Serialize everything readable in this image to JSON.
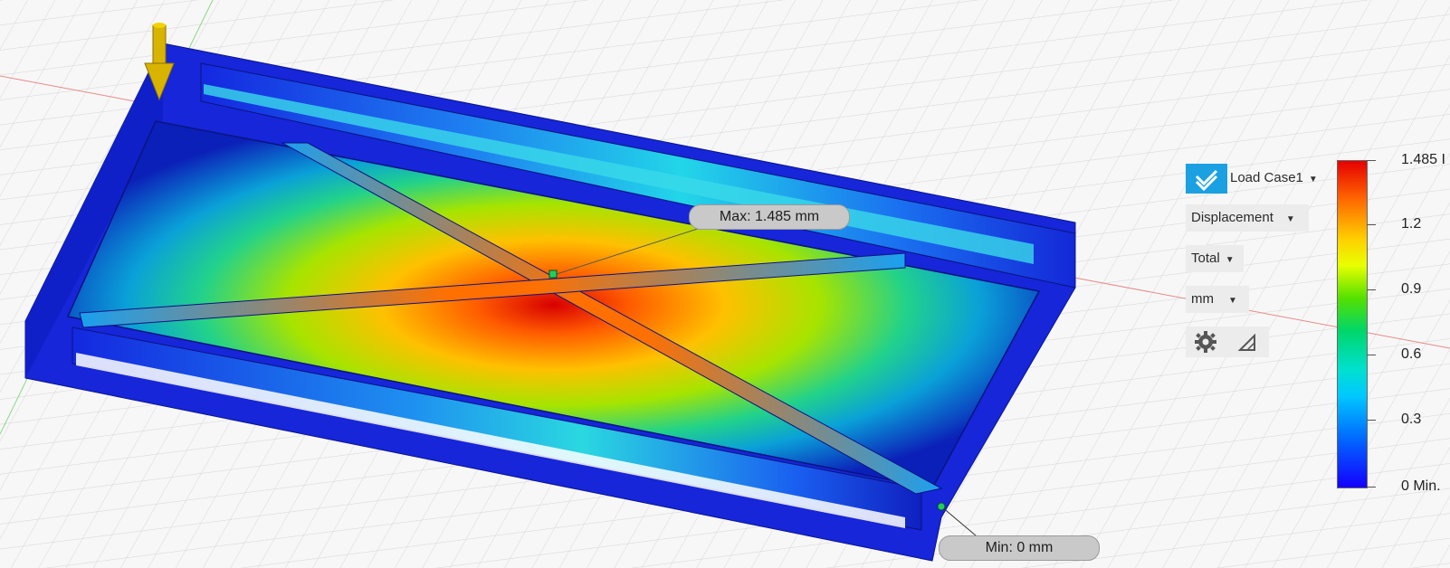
{
  "probes": {
    "max_label": "Max: 1.485 mm",
    "min_label": "Min: 0 mm"
  },
  "result_panel": {
    "load_case": "Load Case1",
    "result_type": "Displacement",
    "component": "Total",
    "unit": "mm",
    "icons": [
      "check-icon",
      "gear-icon",
      "probe-triangle-icon"
    ]
  },
  "legend": {
    "max_label": "1.485 I",
    "ticks": [
      "1.2",
      "0.9",
      "0.6",
      "0.3"
    ],
    "min_label": "0 Min.",
    "colors": [
      "#e60000",
      "#ffd000",
      "#55e000",
      "#00e0d0",
      "#0070ff",
      "#1400ff"
    ]
  },
  "model": {
    "load_arrow_color": "#d8b400",
    "frame_color": "#1a2de0"
  }
}
